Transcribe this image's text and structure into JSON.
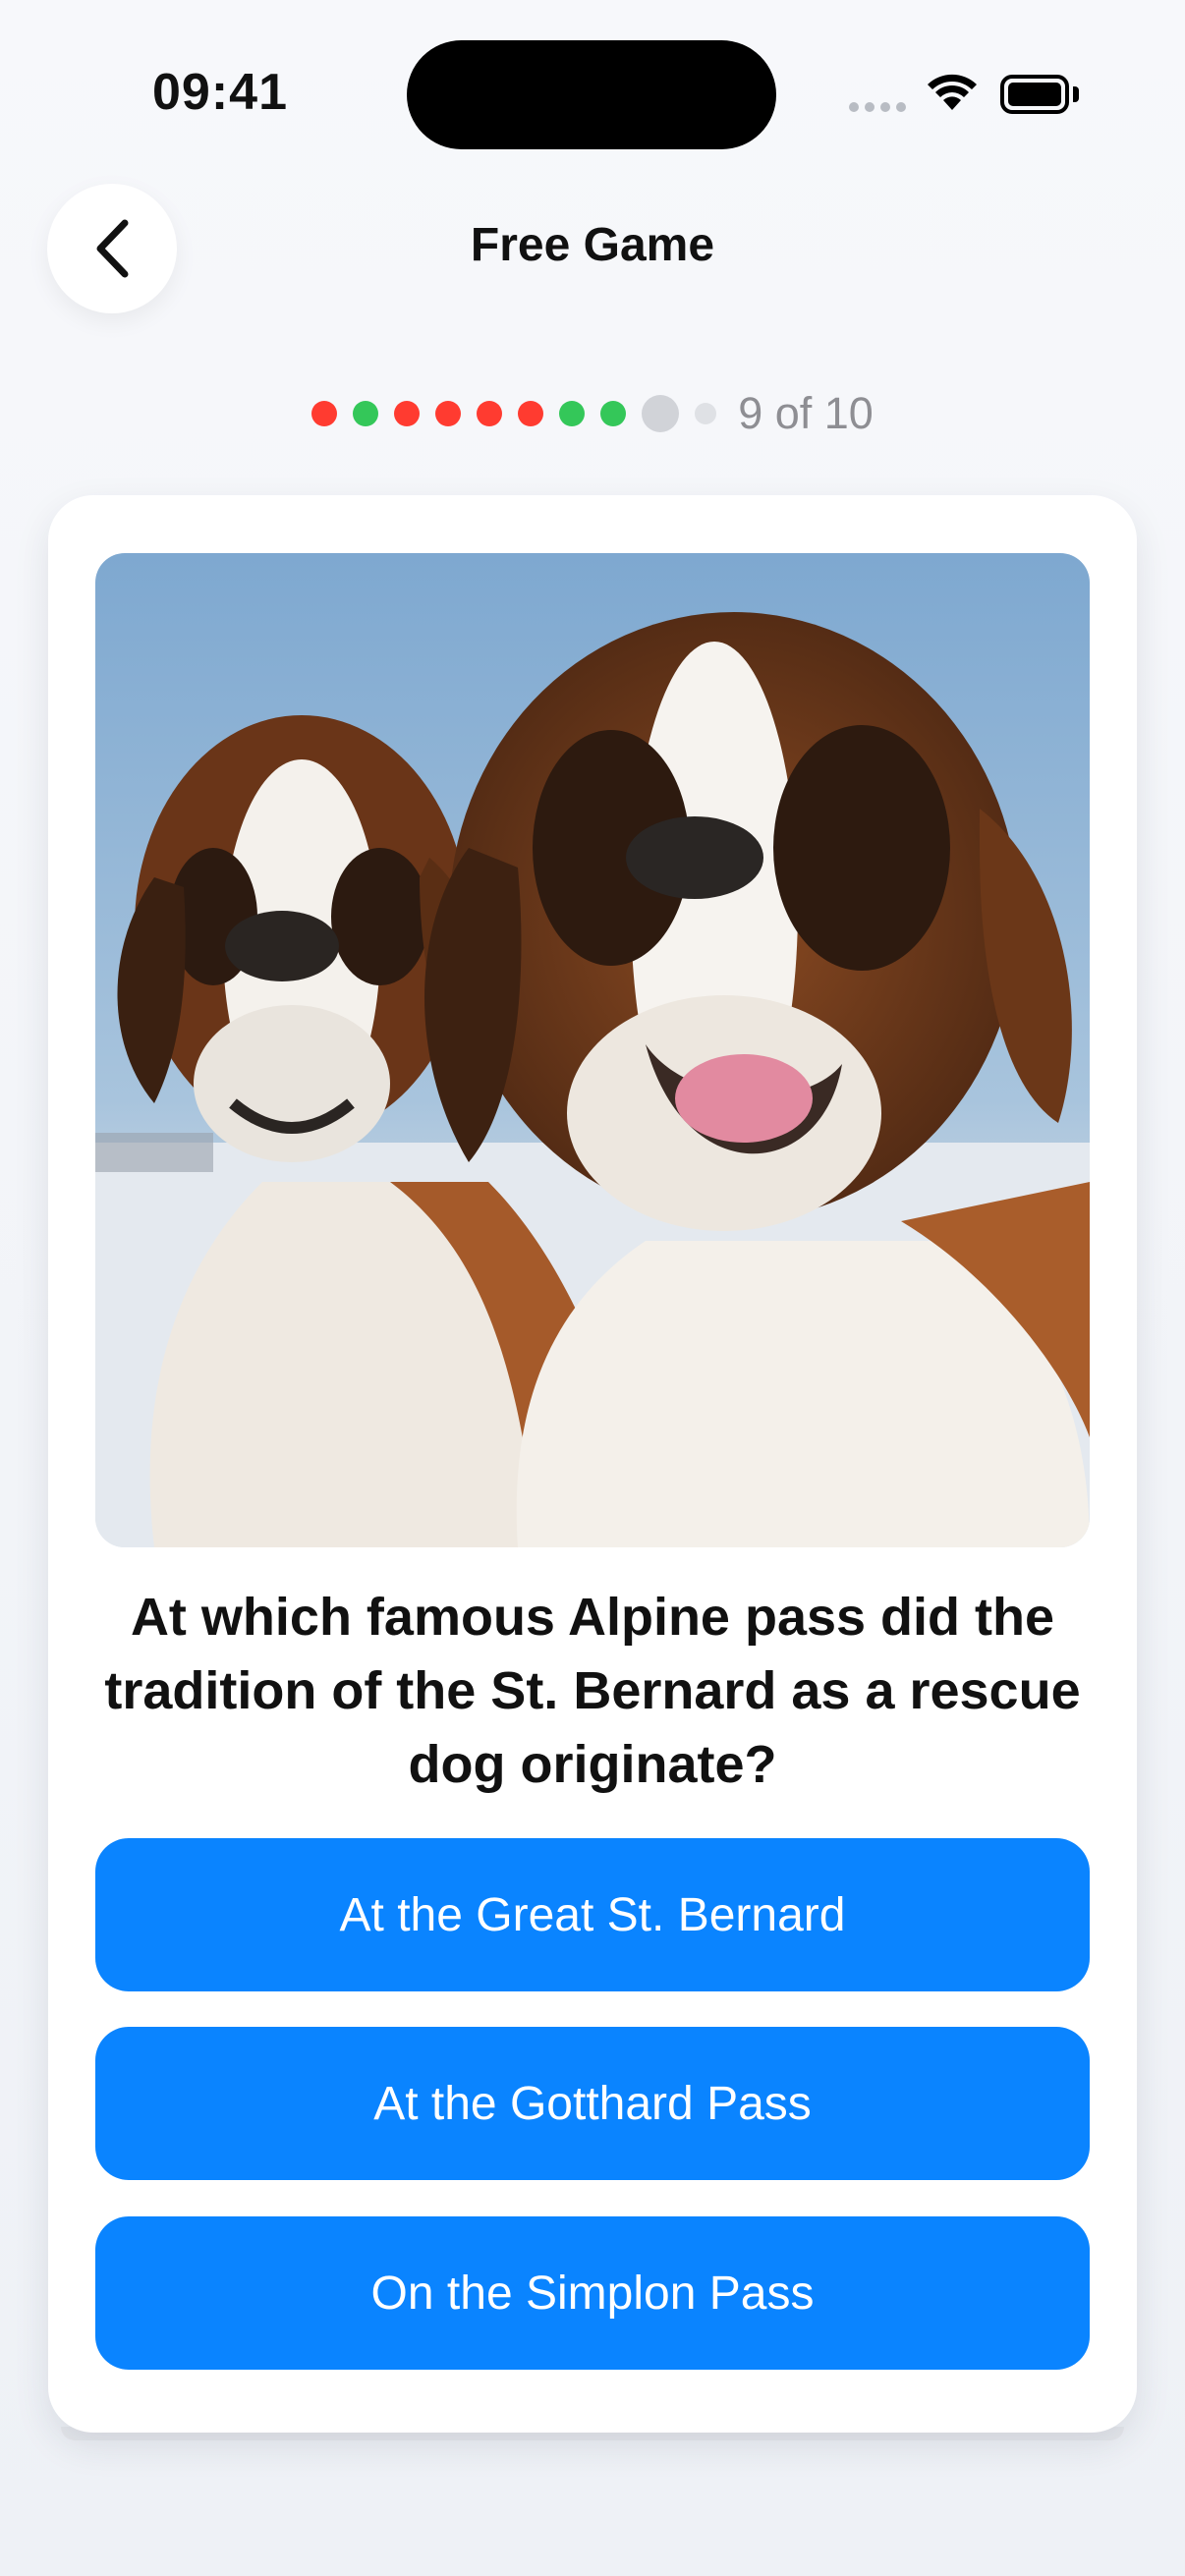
{
  "status_bar": {
    "time": "09:41"
  },
  "header": {
    "title": "Free Game",
    "back_icon": "chevron-left-icon"
  },
  "progress": {
    "results": [
      "wrong",
      "correct",
      "wrong",
      "wrong",
      "wrong",
      "wrong",
      "correct",
      "correct",
      "current",
      "pending"
    ],
    "label": "9 of 10",
    "colors": {
      "wrong": "#ff3b30",
      "correct": "#34c759",
      "current": "#d1d3d8",
      "pending": "#dfe1e5"
    }
  },
  "question": {
    "text": "At which famous Alpine pass did the tradition of the St. Bernard as a rescue dog originate?"
  },
  "answers": [
    {
      "label": "At the Great St. Bernard"
    },
    {
      "label": "At the Gotthard Pass"
    },
    {
      "label": "On the Simplon Pass"
    }
  ],
  "theme": {
    "accent": "#0a84ff"
  }
}
